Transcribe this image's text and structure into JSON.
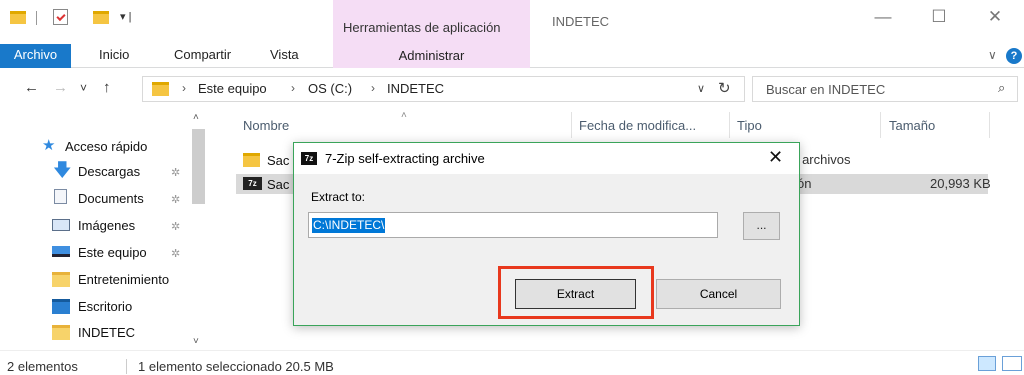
{
  "titlebar": {
    "qa_dropdown": "▾ |",
    "tools_tab": "Herramientas de aplicación",
    "window_title": "INDETEC",
    "minimize": "—",
    "maximize": "☐",
    "close": "✕"
  },
  "ribbon": {
    "file": "Archivo",
    "tabs": [
      "Inicio",
      "Compartir",
      "Vista"
    ],
    "admin": "Administrar",
    "chevron": "∨",
    "help": "?"
  },
  "address": {
    "back": "←",
    "forward": "→",
    "recent": "˅",
    "up": "↑",
    "sep": "›",
    "crumbs": [
      "Este equipo",
      "OS (C:)",
      "INDETEC"
    ],
    "dropdown": "∨",
    "refresh": "↻",
    "search_placeholder": "Buscar en INDETEC",
    "search_icon": "⌕"
  },
  "sidebar": {
    "scroll_up": "˄",
    "scroll_down": "˅",
    "pin": "✲",
    "items": [
      {
        "label": "Acceso rápido",
        "icon": "star-icon"
      },
      {
        "label": "Descargas",
        "icon": "download-icon"
      },
      {
        "label": "Documents",
        "icon": "document-icon"
      },
      {
        "label": "Imágenes",
        "icon": "pictures-icon"
      },
      {
        "label": "Este equipo",
        "icon": "computer-icon"
      },
      {
        "label": "Entretenimiento",
        "icon": "folder-icon"
      },
      {
        "label": "Escritorio",
        "icon": "desktop-icon"
      },
      {
        "label": "INDETEC",
        "icon": "folder-icon"
      }
    ]
  },
  "columns": {
    "name": "Nombre",
    "date": "Fecha de modifica...",
    "type": "Tipo",
    "size": "Tamaño",
    "sort_arrow": "˄"
  },
  "files": [
    {
      "name": "Sac",
      "type": "de archivos",
      "size": ""
    },
    {
      "name": "Sac",
      "type": "ón",
      "size": "20,993 KB"
    }
  ],
  "status": {
    "count": "2 elementos",
    "selection": "1 elemento seleccionado  20.5 MB"
  },
  "dialog": {
    "icon_text": "7z",
    "title": "7-Zip self-extracting archive",
    "close": "✕",
    "label": "Extract to:",
    "path": "C:\\INDETEC\\",
    "browse": "...",
    "extract": "Extract",
    "cancel": "Cancel"
  },
  "colors": {
    "accent": "#1979ca",
    "tools_tab": "#f5ddf5",
    "highlight": "#e8381d",
    "dialog_border": "#3aa45a",
    "selection": "#0078d7"
  }
}
